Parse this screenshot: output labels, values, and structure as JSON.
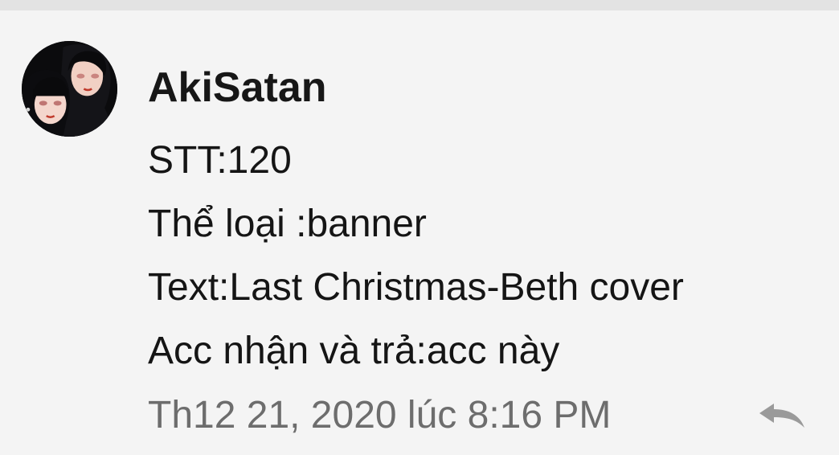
{
  "comment": {
    "author": "AkiSatan",
    "lines": [
      "STT:120",
      "Thể loại :banner",
      "Text:Last Christmas-Beth cover",
      "Acc nhận và trả:acc này"
    ],
    "timestamp": "Th12 21, 2020 lúc 8:16 PM"
  },
  "icons": {
    "reply": "reply-arrow-icon",
    "avatar": "profile-picture"
  },
  "colors": {
    "background": "#f4f4f4",
    "text": "#151515",
    "timestamp": "#6d6d6d",
    "reply_icon": "#9a9a9a"
  }
}
